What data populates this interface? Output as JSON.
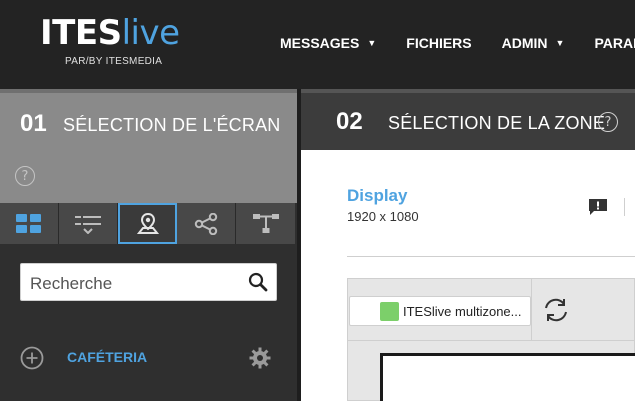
{
  "brand": {
    "name_main": "ITES",
    "name_accent": "live",
    "tagline": "PAR/BY ITESMEDIA",
    "accent_color": "#4fa3e0"
  },
  "nav": {
    "items": [
      {
        "label": "MESSAGES",
        "has_dropdown": true
      },
      {
        "label": "FICHIERS",
        "has_dropdown": false
      },
      {
        "label": "ADMIN",
        "has_dropdown": true
      },
      {
        "label": "PARAM",
        "has_dropdown": false
      }
    ]
  },
  "step1": {
    "number": "01",
    "title": "SÉLECTION DE L'ÉCRAN",
    "help": "?"
  },
  "step2": {
    "number": "02",
    "title": "SÉLECTION DE LA ZONE",
    "help": "?"
  },
  "toolbar": {
    "tools": [
      {
        "icon": "grid-view-icon",
        "active": false
      },
      {
        "icon": "filter-list-icon",
        "active": false
      },
      {
        "icon": "map-pin-icon",
        "active": true
      },
      {
        "icon": "share-nodes-icon",
        "active": false
      },
      {
        "icon": "hierarchy-icon",
        "active": false
      }
    ]
  },
  "search": {
    "placeholder": "Recherche",
    "icon": "search-icon"
  },
  "tree": {
    "items": [
      {
        "label": "CAFÉTERIA",
        "icon": "add-circle-icon",
        "action_icon": "gear-icon"
      }
    ]
  },
  "display": {
    "title": "Display",
    "resolution": "1920 x 1080"
  },
  "zone": {
    "selected_label": "ITESlive multizone...",
    "swatch_color": "#7ccf6a"
  }
}
